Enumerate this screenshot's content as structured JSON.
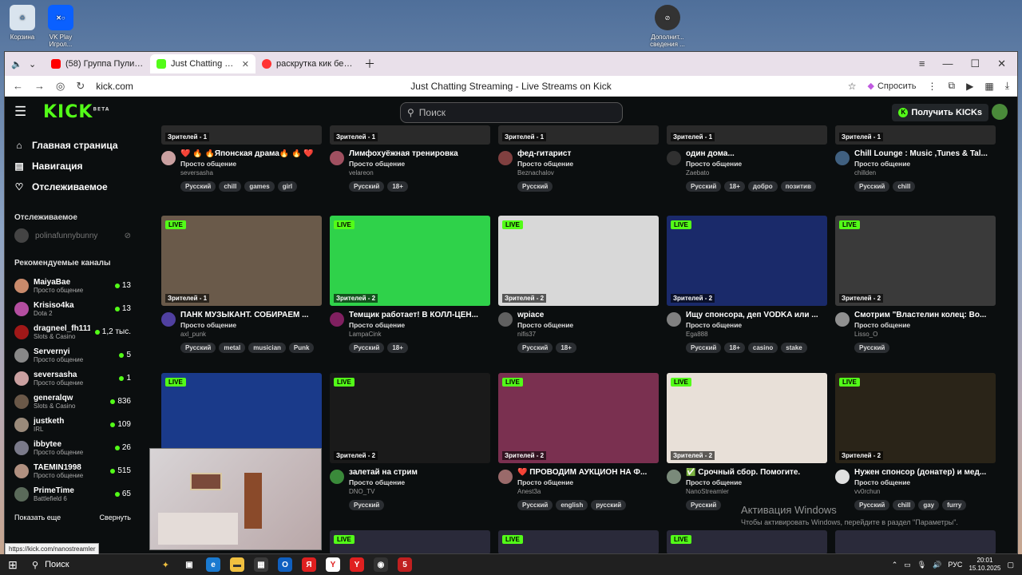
{
  "desktop": {
    "icons": [
      {
        "label": "Корзина"
      },
      {
        "label": "VK Play Игрол..."
      },
      {
        "label": "Дополнит... сведения ..."
      }
    ]
  },
  "browser": {
    "tabs": [
      {
        "title": "(58) Группа Пули Дни - Л"
      },
      {
        "title": "Just Chatting Streams"
      },
      {
        "title": "раскрутка кик беслатно"
      }
    ],
    "url": "kick.com",
    "page_title": "Just Chatting Streaming - Live Streams on Kick",
    "ask_label": "Спросить"
  },
  "kick": {
    "logo": "KICK",
    "logo_sup": "BETA",
    "search_placeholder": "Поиск",
    "get_kicks": "Получить KICKs",
    "nav": [
      {
        "label": "Главная страница",
        "icon": "home-icon"
      },
      {
        "label": "Навигация",
        "icon": "compass-icon"
      },
      {
        "label": "Отслеживаемое",
        "icon": "heart-icon"
      }
    ],
    "followed_header": "Отслеживаемое",
    "followed_user": "polinafunnybunny",
    "recommended_header": "Рекомендуемые каналы",
    "channels": [
      {
        "name": "MaiyaBae",
        "cat": "Просто общение",
        "count": "13",
        "color": "#c98a6b"
      },
      {
        "name": "Krisiso4ka",
        "cat": "Dota 2",
        "count": "13",
        "color": "#b44ea0"
      },
      {
        "name": "dragneel_fh111",
        "cat": "Slots & Casino",
        "count": "1,2 тыс.",
        "color": "#a01818"
      },
      {
        "name": "Servernyi",
        "cat": "Просто общение",
        "count": "5",
        "color": "#888888"
      },
      {
        "name": "seversasha",
        "cat": "Просто общение",
        "count": "1",
        "color": "#caa0a0"
      },
      {
        "name": "generalqw",
        "cat": "Slots & Casino",
        "count": "836",
        "color": "#6a5848"
      },
      {
        "name": "justketh",
        "cat": "IRL",
        "count": "109",
        "color": "#9a8a7a"
      },
      {
        "name": "ibbytee",
        "cat": "Просто общение",
        "count": "26",
        "color": "#7a7a8a"
      },
      {
        "name": "TAEMIN1998",
        "cat": "Просто общение",
        "count": "515",
        "color": "#b09080"
      },
      {
        "name": "PrimeTime",
        "cat": "Battlefield 6",
        "count": "65",
        "color": "#5a6a5a"
      }
    ],
    "show_more": "Показать еще",
    "collapse": "Свернуть",
    "live_label": "LIVE",
    "streams_top": [
      {
        "viewers": "Зрителей - 1",
        "title": "❤️ 🔥 🔥Японская драма🔥 🔥 ❤️",
        "cat": "Просто общение",
        "user": "seversasha",
        "tags": [
          "Русский",
          "chill",
          "games",
          "girl"
        ],
        "av": "#caa0a0"
      },
      {
        "viewers": "Зрителей - 1",
        "title": "Лимфохуёжная тренировка",
        "cat": "Просто общение",
        "user": "velareon",
        "tags": [
          "Русский",
          "18+"
        ],
        "av": "#a05060"
      },
      {
        "viewers": "Зрителей - 1",
        "title": "фед-гитарист",
        "cat": "Просто общение",
        "user": "Beznachalov",
        "tags": [
          "Русский"
        ],
        "av": "#804040"
      },
      {
        "viewers": "Зрителей - 1",
        "title": "один дома...",
        "cat": "Просто общение",
        "user": "Zaebato",
        "tags": [
          "Русский",
          "18+",
          "добро",
          "позитив"
        ],
        "av": "#303030"
      },
      {
        "viewers": "Зрителей - 1",
        "title": "Chill Lounge : Music ,Tunes & Tal...",
        "cat": "Просто общение",
        "user": "chillden",
        "tags": [
          "Русский",
          "chill"
        ],
        "av": "#406080"
      }
    ],
    "streams_mid": [
      {
        "viewers": "Зрителей - 1",
        "title": "ПАНК МУЗЫКАНТ. СОБИРАЕМ ...",
        "cat": "Просто общение",
        "user": "axl_punk",
        "tags": [
          "Русский",
          "metal",
          "musician",
          "Punk"
        ],
        "av": "#5040a0",
        "bg": "#6a5a4a"
      },
      {
        "viewers": "Зрителей - 2",
        "title": "Темщик работает! В КОЛЛ-ЦЕН...",
        "cat": "Просто общение",
        "user": "LampaCink",
        "tags": [
          "Русский",
          "18+"
        ],
        "av": "#802060",
        "bg": "#2fd24a"
      },
      {
        "viewers": "Зрителей - 2",
        "title": "wpiace",
        "cat": "Просто общение",
        "user": "nifis37",
        "tags": [
          "Русский",
          "18+"
        ],
        "av": "#606060",
        "bg": "#d8d8d8"
      },
      {
        "viewers": "Зрителей - 2",
        "title": "Ищу спонсора, деп VODKA или ...",
        "cat": "Просто общение",
        "user": "Ega888",
        "tags": [
          "Русский",
          "18+",
          "casino",
          "stake"
        ],
        "av": "#808080",
        "bg": "#1a2a6a"
      },
      {
        "viewers": "Зрителей - 2",
        "title": "Смотрим \"Властелин колец: Во...",
        "cat": "Просто общение",
        "user": "Lisso_O",
        "tags": [
          "Русский"
        ],
        "av": "#909090",
        "bg": "#3a3a3a"
      }
    ],
    "streams_bottom": [
      {
        "viewers": "",
        "title": "",
        "cat": "",
        "user": "",
        "tags": [],
        "av": "#000",
        "bg": "#1a3a8a"
      },
      {
        "viewers": "Зрителей - 2",
        "title": "залетай на стрим",
        "cat": "Просто общение",
        "user": "DNO_TV",
        "tags": [
          "Русский"
        ],
        "av": "#3a8a3a",
        "bg": "#1a1a1a"
      },
      {
        "viewers": "Зрителей - 2",
        "title": "❤️ ПРОВОДИМ АУКЦИОН НА Ф...",
        "cat": "Просто общение",
        "user": "Anest3a",
        "tags": [
          "Русский",
          "english",
          "русский"
        ],
        "av": "#9a6a6a",
        "bg": "#7a3050"
      },
      {
        "viewers": "Зрителей - 2",
        "title": "✅ Срочный сбор. Помогите.",
        "cat": "Просто общение",
        "user": "NanoStreamler",
        "tags": [
          "Русский"
        ],
        "av": "#7a8a7a",
        "bg": "#e8e0d8"
      },
      {
        "viewers": "Зрителей - 2",
        "title": "Нужен спонсор (донатер) и мед...",
        "cat": "Просто общение",
        "user": "vv0rchun",
        "tags": [
          "Русский",
          "chill",
          "gay",
          "furry"
        ],
        "av": "#e0e0e0",
        "bg": "#2a2418"
      }
    ]
  },
  "activation": {
    "line1": "Активация Windows",
    "line2": "Чтобы активировать Windows, перейдите в раздел \"Параметры\"."
  },
  "status_url": "https://kick.com/nanostreamler",
  "taskbar": {
    "search": "Поиск",
    "lang": "РУС",
    "time": "20:01",
    "date": "15.10.2025"
  }
}
